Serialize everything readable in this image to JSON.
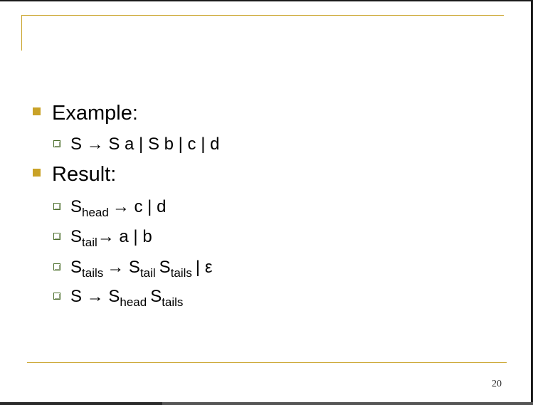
{
  "slide": {
    "page_number": "20",
    "accent_color": "#c9a227",
    "items": [
      {
        "type": "heading",
        "text": "Example:"
      },
      {
        "type": "rule",
        "parts": [
          "S → S a | S b | c | d"
        ]
      },
      {
        "type": "heading",
        "text": "Result:"
      },
      {
        "type": "rule",
        "parts": [
          "S",
          "head",
          "→ c | d"
        ]
      },
      {
        "type": "rule",
        "parts": [
          "S",
          "tail",
          "→ a | b"
        ]
      },
      {
        "type": "rule",
        "parts": [
          "S",
          "tails",
          "→ S",
          "tail",
          "S",
          "tails",
          "| ε"
        ]
      },
      {
        "type": "rule",
        "parts": [
          "S → S",
          "head",
          "S",
          "tails"
        ]
      }
    ]
  }
}
